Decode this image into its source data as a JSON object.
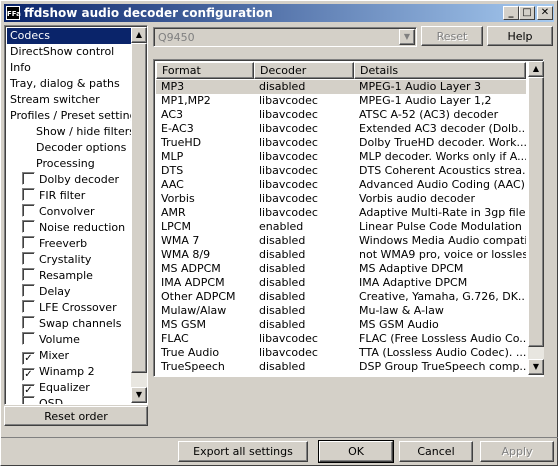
{
  "window": {
    "title": "ffdshow audio decoder configuration",
    "app_icon_text": "FFa"
  },
  "titlebar_buttons": {
    "minimize": "_",
    "maximize": "□",
    "close": "✕"
  },
  "tree": {
    "items": [
      {
        "label": "Codecs",
        "checkbox": null,
        "selected": true
      },
      {
        "label": "DirectShow control",
        "checkbox": null
      },
      {
        "label": "Info",
        "checkbox": null
      },
      {
        "label": "Tray, dialog & paths",
        "checkbox": null
      },
      {
        "label": "Stream switcher",
        "checkbox": null
      },
      {
        "label": "Profiles / Preset settings",
        "checkbox": null
      },
      {
        "label": "Show / hide filters",
        "checkbox": null,
        "indent": 2
      },
      {
        "label": "Decoder options",
        "checkbox": null,
        "indent": 2
      },
      {
        "label": "Processing",
        "checkbox": null,
        "indent": 2
      },
      {
        "label": "Dolby decoder",
        "checkbox": false
      },
      {
        "label": "FIR filter",
        "checkbox": false
      },
      {
        "label": "Convolver",
        "checkbox": false
      },
      {
        "label": "Noise reduction",
        "checkbox": false
      },
      {
        "label": "Freeverb",
        "checkbox": false
      },
      {
        "label": "Crystality",
        "checkbox": false
      },
      {
        "label": "Resample",
        "checkbox": false
      },
      {
        "label": "Delay",
        "checkbox": false
      },
      {
        "label": "LFE Crossover",
        "checkbox": false
      },
      {
        "label": "Swap channels",
        "checkbox": false
      },
      {
        "label": "Volume",
        "checkbox": false
      },
      {
        "label": "Mixer",
        "checkbox": true
      },
      {
        "label": "Winamp 2",
        "checkbox": true
      },
      {
        "label": "Equalizer",
        "checkbox": true
      },
      {
        "label": "OSD",
        "checkbox": false
      }
    ]
  },
  "reset_order_label": "Reset order",
  "combo": {
    "value": "Q9450"
  },
  "reset_label": "Reset",
  "help_label": "Help",
  "list": {
    "columns": [
      "Format",
      "Decoder",
      "Details"
    ],
    "rows": [
      [
        "MP3",
        "disabled",
        "MPEG-1 Audio Layer 3"
      ],
      [
        "MP1,MP2",
        "libavcodec",
        "MPEG-1 Audio Layer 1,2"
      ],
      [
        "AC3",
        "libavcodec",
        "ATSC A-52 (AC3) decoder"
      ],
      [
        "E-AC3",
        "libavcodec",
        "Extended AC3 decoder (Dolb..."
      ],
      [
        "TrueHD",
        "libavcodec",
        "Dolby TrueHD decoder. Work..."
      ],
      [
        "MLP",
        "libavcodec",
        "MLP decoder. Works only if A..."
      ],
      [
        "DTS",
        "libavcodec",
        "DTS Coherent Acoustics strea..."
      ],
      [
        "AAC",
        "libavcodec",
        "Advanced Audio Coding (AAC)"
      ],
      [
        "Vorbis",
        "libavcodec",
        "Vorbis audio decoder"
      ],
      [
        "AMR",
        "libavcodec",
        "Adaptive Multi-Rate in 3gp file..."
      ],
      [
        "LPCM",
        "enabled",
        "Linear Pulse Code Modulation"
      ],
      [
        "WMA 7",
        "disabled",
        "Windows Media Audio compati..."
      ],
      [
        "WMA 8/9",
        "disabled",
        "not WMA9 pro, voice or lossless"
      ],
      [
        "MS ADPCM",
        "disabled",
        "MS Adaptive DPCM"
      ],
      [
        "IMA ADPCM",
        "disabled",
        "IMA Adaptive DPCM"
      ],
      [
        "Other ADPCM",
        "disabled",
        "Creative, Yamaha, G.726, DK..."
      ],
      [
        "Mulaw/Alaw",
        "disabled",
        "Mu-law & A-law"
      ],
      [
        "MS GSM",
        "disabled",
        "MS GSM Audio"
      ],
      [
        "FLAC",
        "libavcodec",
        "FLAC (Free Lossless Audio Co..."
      ],
      [
        "True Audio",
        "libavcodec",
        "TTA (Lossless Audio Codec). ..."
      ],
      [
        "TrueSpeech",
        "disabled",
        "DSP Group TrueSpeech comp..."
      ]
    ]
  },
  "footer": {
    "export_label": "Export all settings",
    "ok_label": "OK",
    "cancel_label": "Cancel",
    "apply_label": "Apply"
  }
}
